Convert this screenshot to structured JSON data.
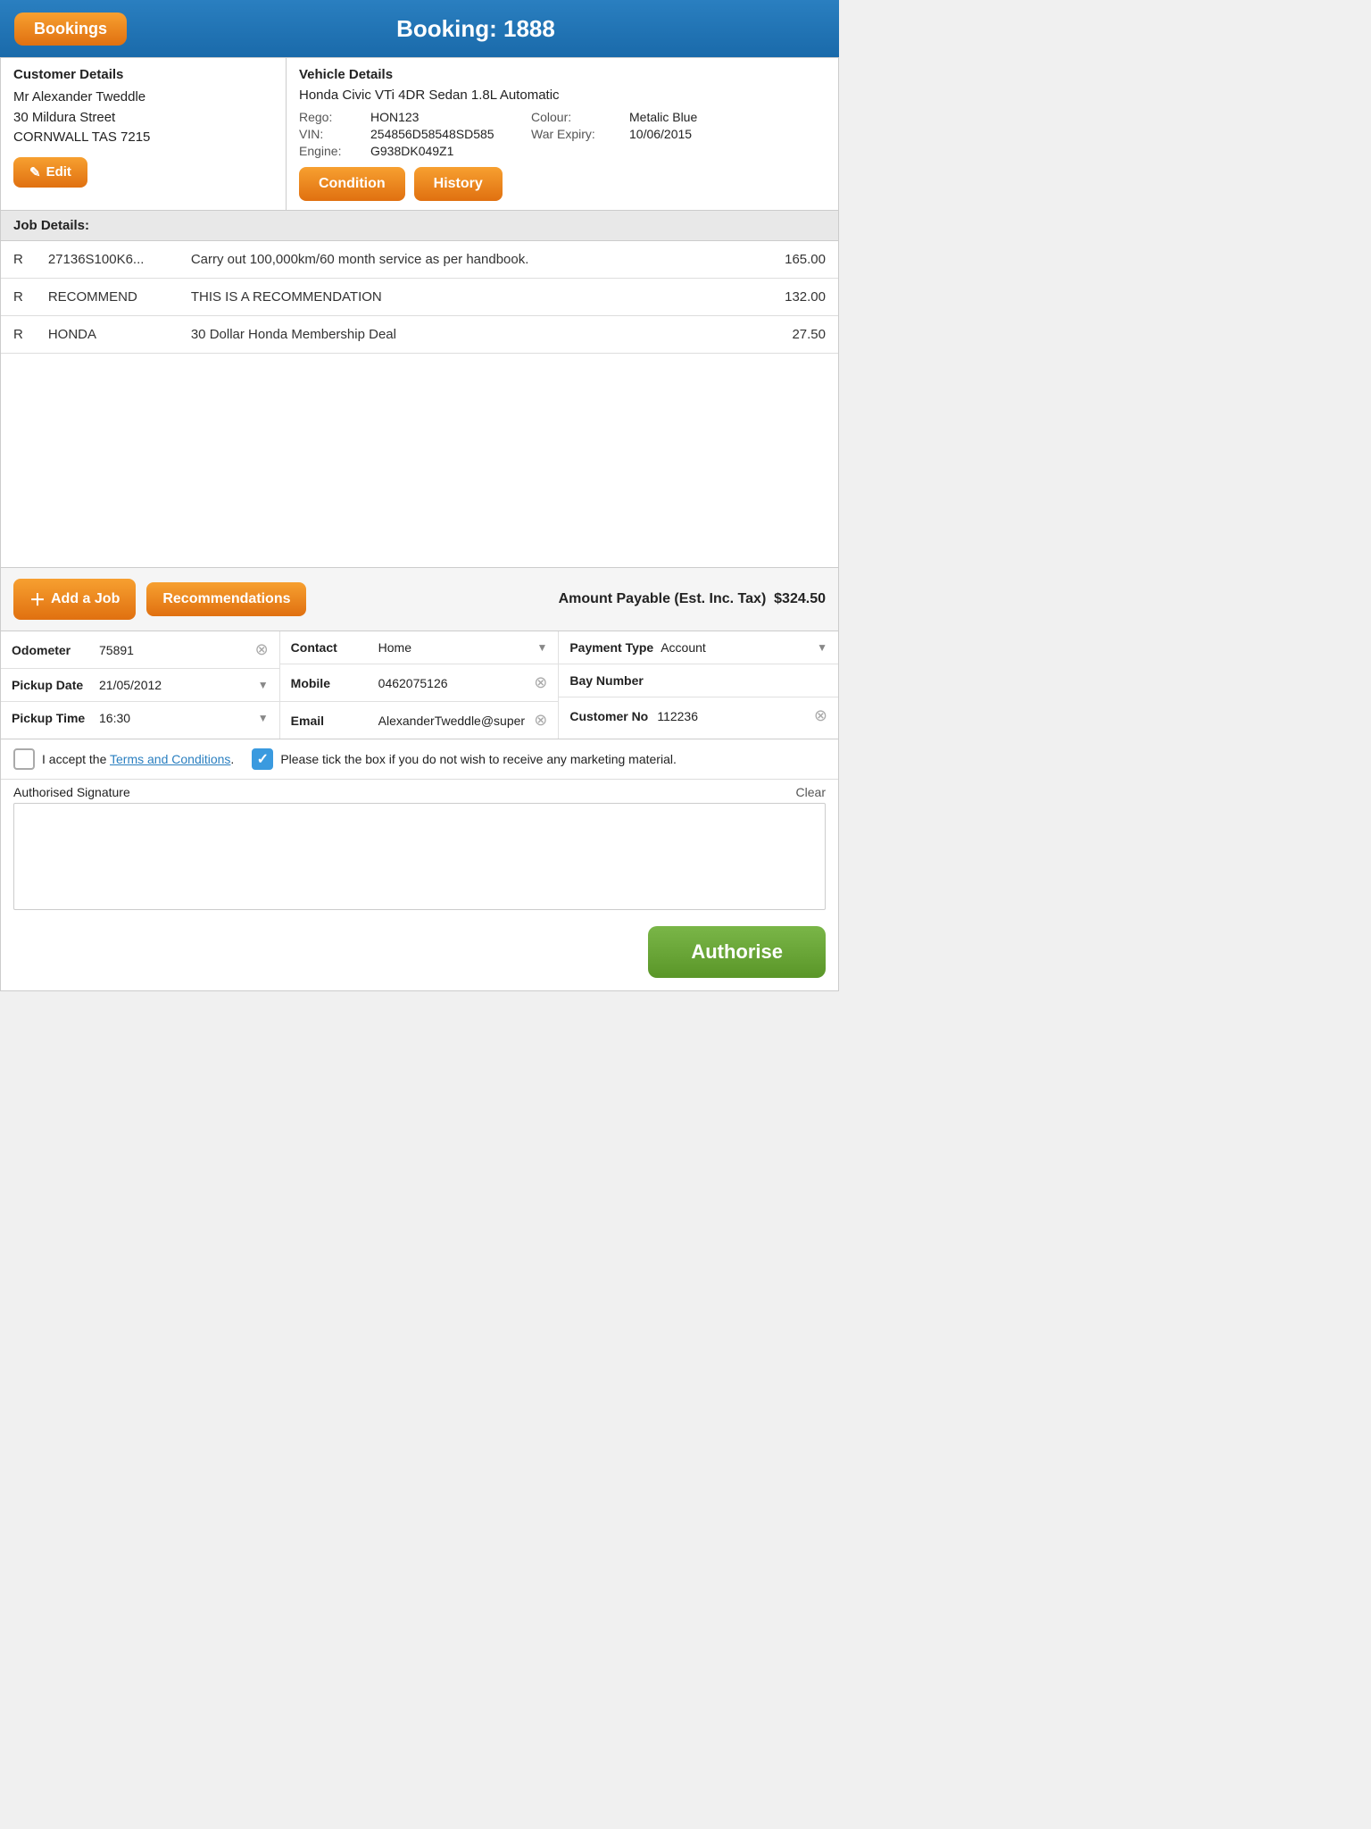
{
  "header": {
    "bookings_label": "Bookings",
    "title": "Booking: 1888"
  },
  "customer": {
    "section_title": "Customer Details",
    "name": "Mr Alexander Tweddle",
    "address1": "30 Mildura Street",
    "address2": "CORNWALL TAS 7215",
    "edit_label": "Edit"
  },
  "vehicle": {
    "section_title": "Vehicle Details",
    "model": "Honda Civic VTi 4DR Sedan 1.8L Automatic",
    "rego_label": "Rego:",
    "rego_value": "HON123",
    "colour_label": "Colour:",
    "colour_value": "Metalic Blue",
    "vin_label": "VIN:",
    "vin_value": "254856D58548SD585",
    "war_expiry_label": "War Expiry:",
    "war_expiry_value": "10/06/2015",
    "engine_label": "Engine:",
    "engine_value": "G938DK049Z1",
    "condition_label": "Condition",
    "history_label": "History"
  },
  "jobs": {
    "section_title": "Job Details:",
    "items": [
      {
        "prefix": "R",
        "code": "27136S100K6...",
        "description": "Carry out 100,000km/60 month service as per handbook.",
        "amount": "165.00"
      },
      {
        "prefix": "R",
        "code": "RECOMMEND",
        "description": "THIS IS A RECOMMENDATION",
        "amount": "132.00"
      },
      {
        "prefix": "R",
        "code": "HONDA",
        "description": "30 Dollar Honda Membership Deal",
        "amount": "27.50"
      }
    ]
  },
  "toolbar": {
    "add_job_label": "Add a Job",
    "recommendations_label": "Recommendations",
    "amount_label": "Amount Payable (Est. Inc. Tax)",
    "amount_value": "$324.50"
  },
  "form": {
    "odometer_label": "Odometer",
    "odometer_value": "75891",
    "contact_label": "Contact",
    "contact_value": "Home",
    "payment_type_label": "Payment Type",
    "payment_type_value": "Account",
    "pickup_date_label": "Pickup Date",
    "pickup_date_value": "21/05/2012",
    "mobile_label": "Mobile",
    "mobile_value": "0462075126",
    "bay_number_label": "Bay Number",
    "bay_number_value": "",
    "pickup_time_label": "Pickup Time",
    "pickup_time_value": "16:30",
    "email_label": "Email",
    "email_value": "AlexanderTweddle@super",
    "customer_no_label": "Customer No",
    "customer_no_value": "112236"
  },
  "checkboxes": {
    "terms_prefix": "I accept the ",
    "terms_link": "Terms and Conditions",
    "terms_suffix": ".",
    "terms_checked": false,
    "marketing_text": "Please tick the box if you do not wish to receive any marketing material.",
    "marketing_checked": true
  },
  "signature": {
    "label": "Authorised Signature",
    "clear_label": "Clear"
  },
  "authorise": {
    "label": "Authorise"
  }
}
